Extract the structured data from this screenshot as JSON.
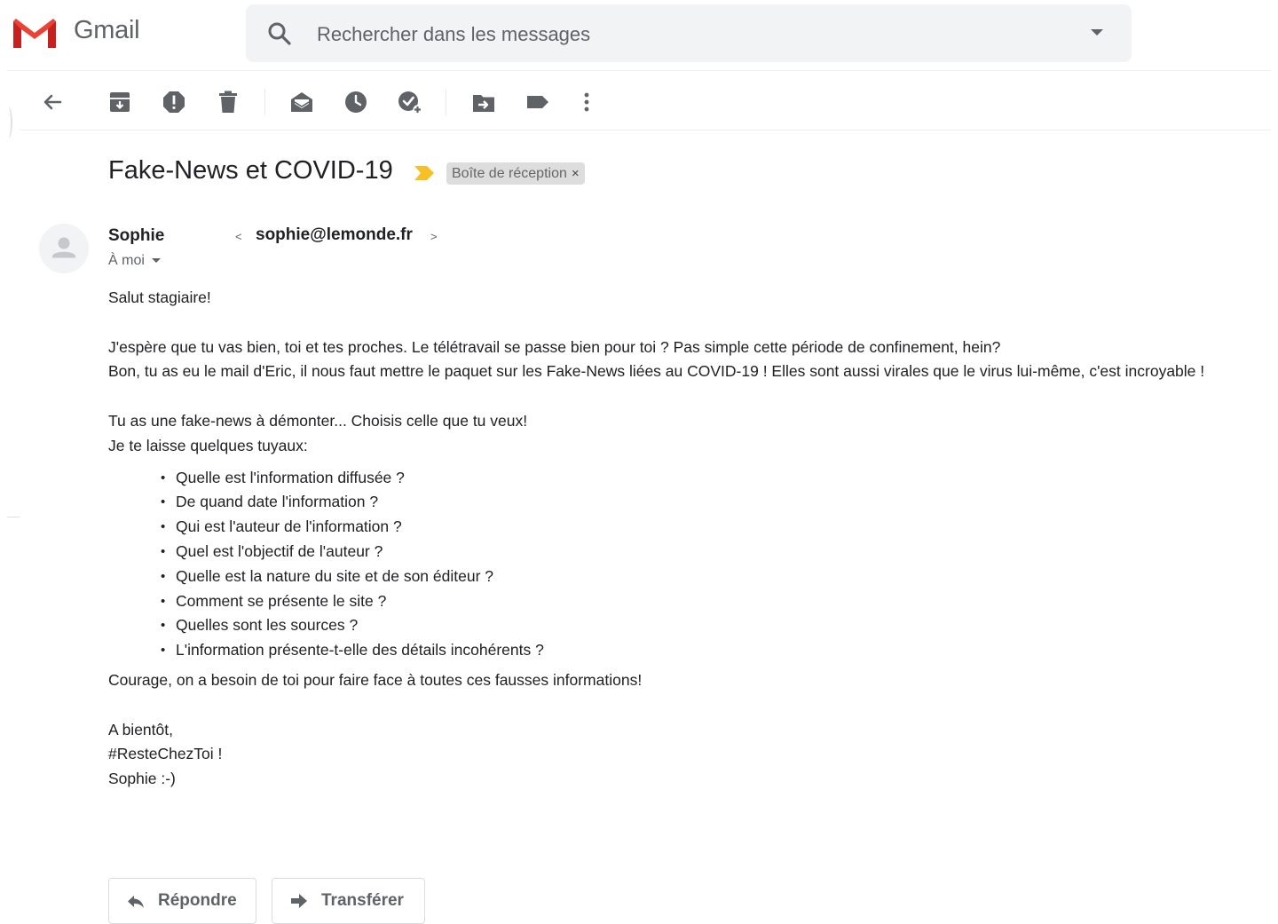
{
  "app": {
    "name": "Gmail"
  },
  "search": {
    "placeholder": "Rechercher dans les messages"
  },
  "toolbar": {
    "icons": [
      "back-arrow-icon",
      "archive-icon",
      "report-spam-icon",
      "delete-icon",
      "mark-unread-icon",
      "snooze-icon",
      "add-to-tasks-icon",
      "move-to-icon",
      "labels-icon",
      "more-options-icon"
    ]
  },
  "email": {
    "subject": "Fake-News et COVID-19",
    "label_chip": "Boîte de réception",
    "label_chip_close": "×",
    "sender": {
      "name": "Sophie",
      "email_open": "<",
      "email": "sophie@lemonde.fr",
      "email_close": ">"
    },
    "to": "À moi",
    "body": {
      "greeting": "Salut stagiaire!",
      "para1_line1": "J'espère que tu vas bien, toi et tes proches. Le télétravail se passe bien pour toi ? Pas simple cette période de confinement, hein?",
      "para1_line2": "Bon, tu as eu le mail d'Eric, il nous faut mettre le paquet sur les Fake-News liées au COVID-19 ! Elles sont aussi virales que le virus lui-même, c'est incroyable !",
      "para2_line1": "Tu as une fake-news à démonter... Choisis celle que tu veux!",
      "para2_line2": "Je te laisse quelques tuyaux:",
      "tips": [
        "Quelle est l'information diffusée ?",
        "De quand date l'information ?",
        "Qui est l'auteur de l'information ?",
        "Quel est l'objectif de l'auteur ?",
        "Quelle est la nature du site et de son éditeur ?",
        "Comment se présente le site  ?",
        "Quelles sont les sources ?",
        "L'information présente-t-elle des détails incohérents ?"
      ],
      "encouragement": "Courage, on a besoin de toi pour faire face à toutes ces fausses informations!",
      "closing1": "A bientôt,",
      "closing2": "#ResteChezToi !",
      "closing3": "Sophie :-)"
    }
  },
  "actions": {
    "reply_label": "Répondre",
    "forward_label": "Transférer"
  },
  "colors": {
    "gmail_red": "#EA4335",
    "important_marker": "#F6C026",
    "search_bg": "#F1F3F4",
    "icon_gray": "#5F6368"
  }
}
